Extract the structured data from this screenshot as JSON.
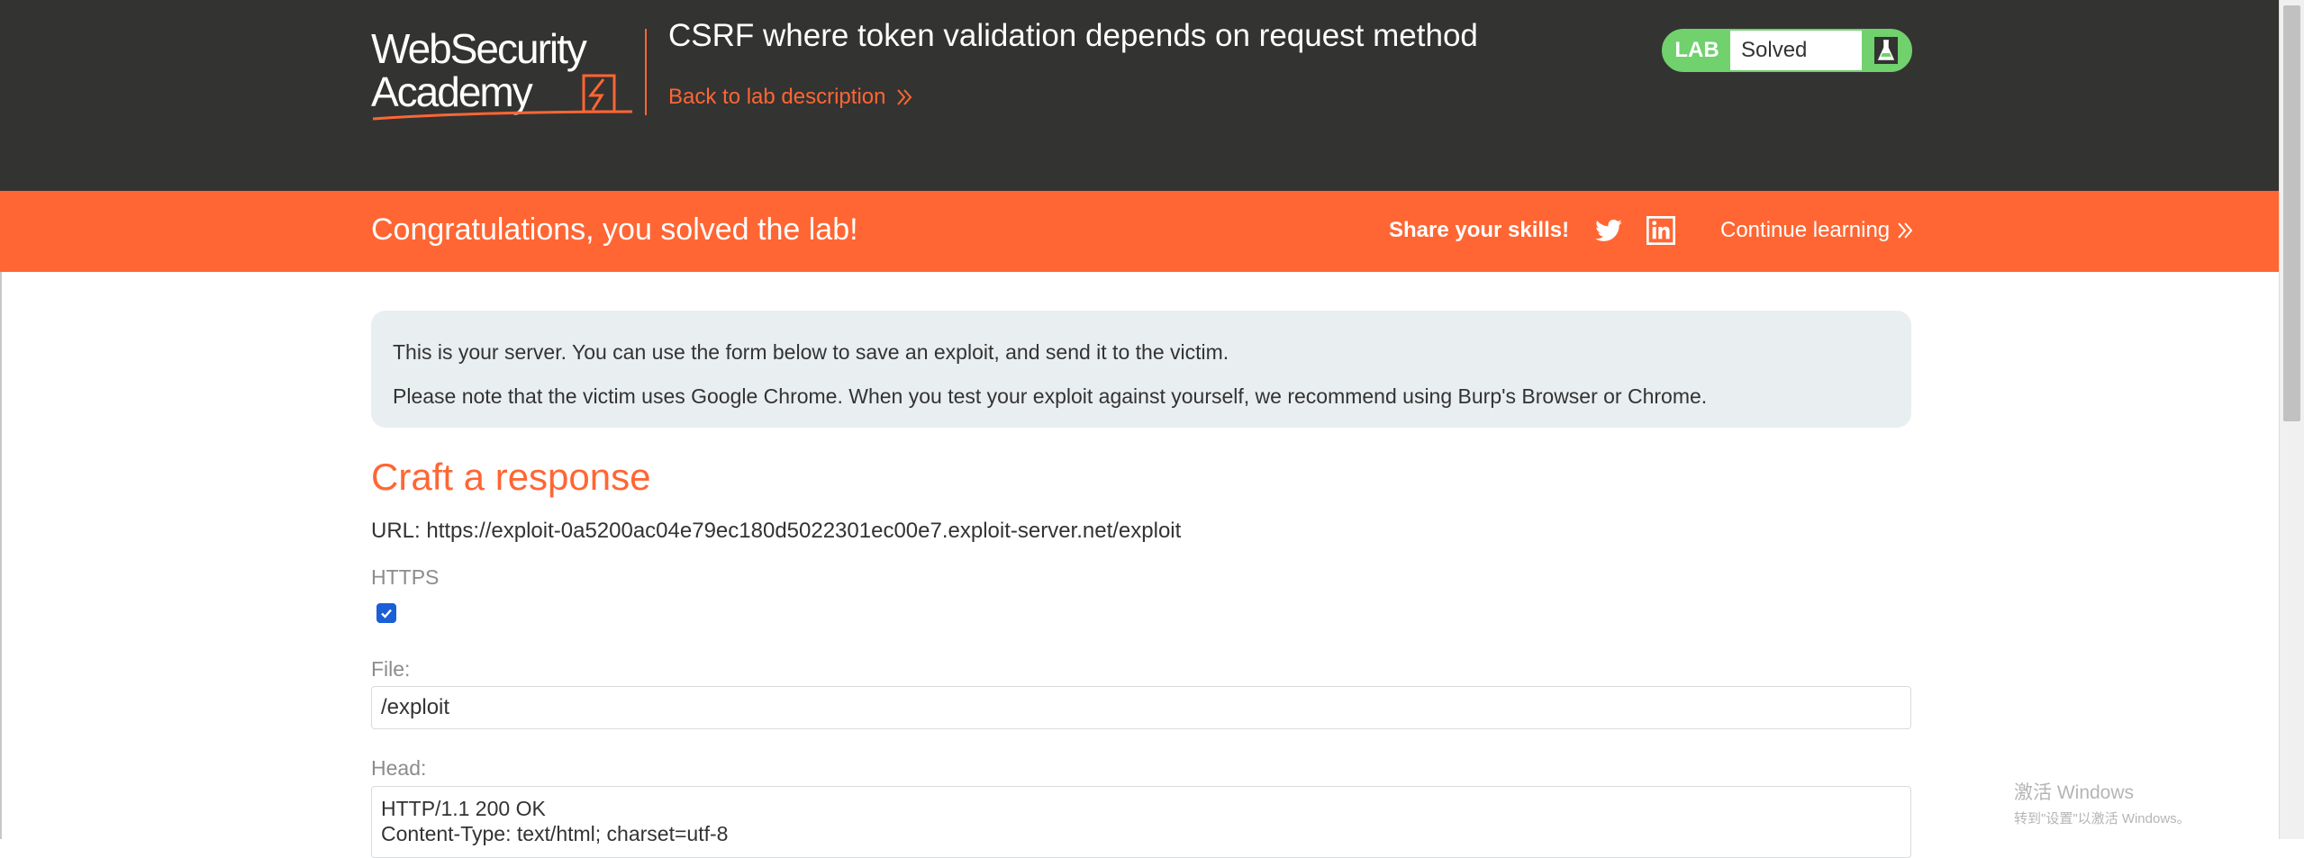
{
  "header": {
    "logo_line1": "WebSecurity",
    "logo_line2": "Academy",
    "title": "CSRF where token validation depends on request method",
    "back_link": "Back to lab description",
    "status": {
      "tag": "LAB",
      "text": "Solved",
      "icon": "flask-icon"
    }
  },
  "banner": {
    "message": "Congratulations, you solved the lab!",
    "share_label": "Share your skills!",
    "share_icons": [
      "twitter-icon",
      "linkedin-icon"
    ],
    "continue_label": "Continue learning"
  },
  "info": {
    "line1": "This is your server. You can use the form below to save an exploit, and send it to the victim.",
    "line2": "Please note that the victim uses Google Chrome. When you test your exploit against yourself, we recommend using Burp's Browser or Chrome."
  },
  "form": {
    "title": "Craft a response",
    "url": "URL: https://exploit-0a5200ac04e79ec180d5022301ec00e7.exploit-server.net/exploit",
    "https_label": "HTTPS",
    "https_checked": true,
    "file_label": "File:",
    "file_value": "/exploit",
    "head_label": "Head:",
    "head_lines": [
      "HTTP/1.1 200 OK",
      "Content-Type: text/html; charset=utf-8"
    ]
  },
  "watermark": {
    "line1": "激活 Windows",
    "line2": "转到\"设置\"以激活 Windows。"
  },
  "colors": {
    "header_bg": "#333332",
    "accent": "#ff6633",
    "solved_green": "#70d16d",
    "info_bg": "#e9eef0"
  }
}
